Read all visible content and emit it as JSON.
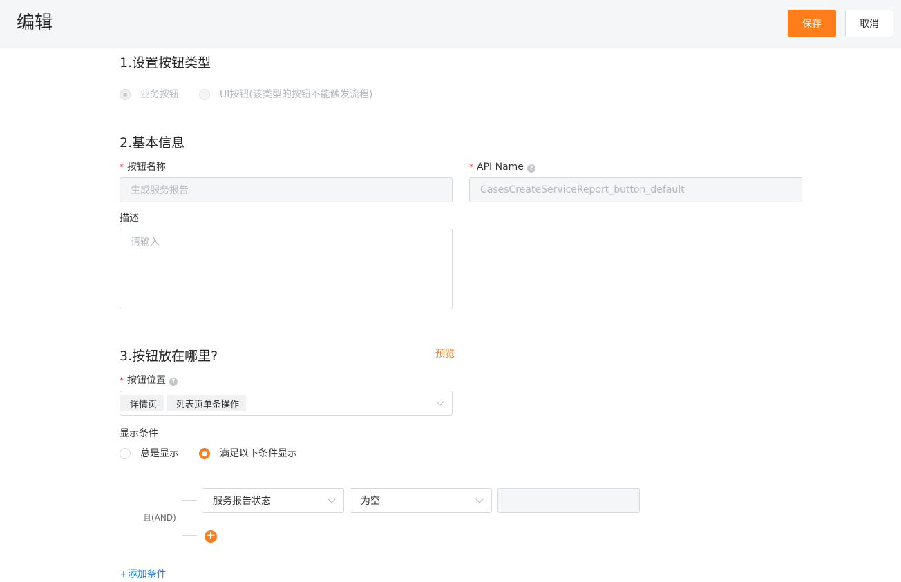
{
  "header": {
    "title": "编辑",
    "save_label": "保存",
    "cancel_label": "取消"
  },
  "section1": {
    "title": "1.设置按钮类型",
    "options": [
      {
        "label": "业务按钮",
        "checked": true,
        "disabled": true
      },
      {
        "label": "UI按钮(该类型的按钮不能触发流程)",
        "checked": false,
        "disabled": true
      }
    ]
  },
  "section2": {
    "title": "2.基本信息",
    "required_mark": "*",
    "button_name": {
      "label": "按钮名称",
      "value": "生成服务报告"
    },
    "api_name": {
      "label": "API Name",
      "value": "CasesCreateServiceReport_button_default"
    },
    "description": {
      "label": "描述",
      "placeholder": "请输入"
    }
  },
  "section3": {
    "title": "3.按钮放在哪里?",
    "preview_label": "预览",
    "position": {
      "label": "按钮位置",
      "tags": [
        "详情页",
        "列表页单条操作"
      ]
    },
    "display_condition": {
      "label": "显示条件",
      "options": [
        {
          "label": "总是显示",
          "checked": false
        },
        {
          "label": "满足以下条件显示",
          "checked": true
        }
      ]
    },
    "condition_group": {
      "logic": "且(AND)",
      "field": "服务报告状态",
      "operator": "为空",
      "value": ""
    },
    "add_condition_label": "+添加条件"
  },
  "icons": {
    "help": "question-circle-icon",
    "dropdown": "chevron-down-icon",
    "add": "plus-circle-icon"
  },
  "colors": {
    "accent": "#ff7d1a",
    "link": "#1e7ff0",
    "required": "#f5222d"
  }
}
